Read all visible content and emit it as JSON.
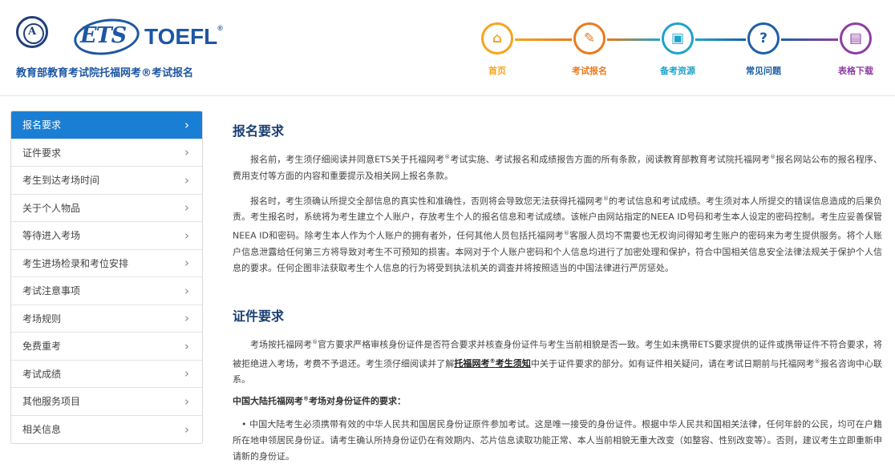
{
  "header": {
    "seal_letter": "A",
    "ets": "ETS",
    "toefl": "TOEFL",
    "toefl_reg": "®",
    "org_subtitle": "教育部教育考试院托福网考®考试报名"
  },
  "nav": {
    "items": [
      {
        "label": "首页",
        "icon": "home-icon",
        "glyph": "⌂",
        "color": "#f5a41f"
      },
      {
        "label": "考试报名",
        "icon": "pencil-icon",
        "glyph": "✎",
        "color": "#ea7a1e"
      },
      {
        "label": "备考资源",
        "icon": "book-icon",
        "glyph": "▣",
        "color": "#1fa3c9"
      },
      {
        "label": "常见问题",
        "icon": "question-icon",
        "glyph": "?",
        "color": "#1e5fa8"
      },
      {
        "label": "表格下载",
        "icon": "document-icon",
        "glyph": "▤",
        "color": "#8e3da3"
      }
    ]
  },
  "sidebar": {
    "items": [
      {
        "label": "报名要求",
        "active": true
      },
      {
        "label": "证件要求"
      },
      {
        "label": "考生到达考场时间"
      },
      {
        "label": "关于个人物品"
      },
      {
        "label": "等待进入考场"
      },
      {
        "label": "考生进场检录和考位安排"
      },
      {
        "label": "考试注意事项"
      },
      {
        "label": "考场规则"
      },
      {
        "label": "免费重考"
      },
      {
        "label": "考试成绩"
      },
      {
        "label": "其他服务项目"
      },
      {
        "label": "相关信息"
      }
    ]
  },
  "content": {
    "s1_title": "报名要求",
    "s1_p1_a": "报名前，考生须仔细阅读并同意ETS关于托福网考",
    "s1_p1_b": "考试实施、考试报名和成绩报告方面的所有条款，阅读教育部教育考试院托福网考",
    "s1_p1_c": "报名网站公布的报名程序、费用支付等方面的内容和重要提示及相关网上报名条款。",
    "s1_p2_a": "报名时，考生须确认所提交全部信息的真实性和准确性，否则将会导致您无法获得托福网考",
    "s1_p2_b": "的考试信息和考试成绩。考生须对本人所提交的错误信息造成的后果负责。考生报名时，系统将为考生建立个人账户，存放考生个人的报名信息和考试成绩。该帐户由网站指定的NEEA ID号码和考生本人设定的密码控制。考生应妥善保管NEEA ID和密码。除考生本人作为个人账户的拥有者外，任何其他人员包括托福网考",
    "s1_p2_c": "客服人员均不需要也无权询问得知考生账户的密码来为考生提供服务。将个人账户信息泄露给任何第三方将导致对考生不可预知的损害。本网对于个人账户密码和个人信息均进行了加密处理和保护，符合中国相关信息安全法律法规关于保护个人信息的要求。任何企图非法获取考生个人信息的行为将受到执法机关的调查并将按照适当的中国法律进行严厉惩处。",
    "s2_title": "证件要求",
    "s2_p1_a": "考场按托福网考",
    "s2_p1_b": "官方要求严格审核身份证件是否符合要求并核查身份证件与考生当前相貌是否一致。考生如未携带ETS要求提供的证件或携带证件不符合要求，将被拒绝进入考场，考费不予退还。考生须仔细阅读并了解",
    "s2_p1_link": "托福网考",
    "s2_p1_link2": "考生须知",
    "s2_p1_c": "中关于证件要求的部分。如有证件相关疑问，请在考试日期前与托福网考",
    "s2_p1_d": "报名咨询中心联系。",
    "s2_sub_a": "中国大陆托福网考",
    "s2_sub_b": "考场对身份证件的要求：",
    "s2_b1": "• 中国大陆考生必须携带有效的中华人民共和国居民身份证原件参加考试。这是唯一接受的身份证件。根据中华人民共和国相关法律，任何年龄的公民，均可在户籍所在地申领居民身份证。请考生确认所持身份证仍在有效期内、芯片信息读取功能正常、本人当前相貌无重大改变（如整容、性别改变等）。否则，建议考生立即重新申请新的身份证。",
    "reg": "®"
  }
}
